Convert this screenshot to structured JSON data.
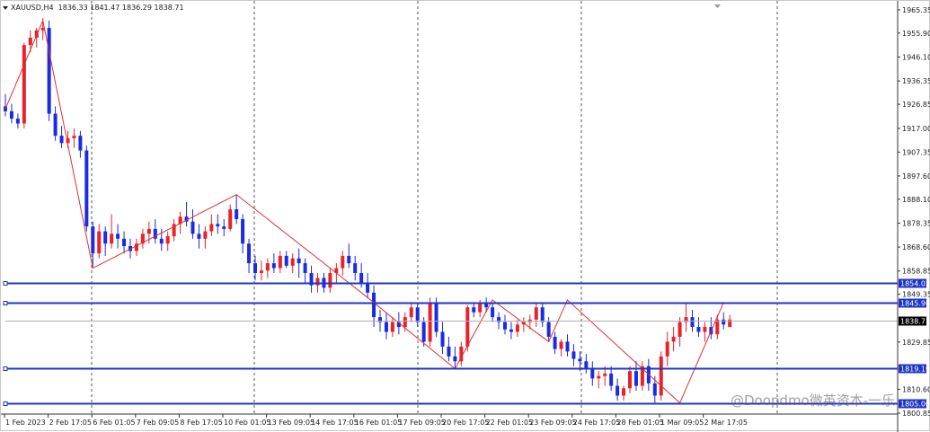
{
  "header": {
    "symbol_timeframe": "XAUUSD,H4",
    "ohlc": "1836.33 1841.47 1836.29 1838.71"
  },
  "watermark": "@Doopdmo微英资本-一乐",
  "colors": {
    "bull": "#e8222a",
    "bear": "#1a2be0",
    "zigzag": "#e03030",
    "level": "#1f35c8",
    "grid": "#555555",
    "current": "#000000"
  },
  "chart_data": {
    "type": "candlestick",
    "symbol": "XAUUSD",
    "timeframe": "H4",
    "ylim": [
      1800.85,
      1965.35
    ],
    "price_ticks": [
      1965.35,
      1955.9,
      1946.1,
      1936.35,
      1926.85,
      1917.0,
      1907.35,
      1897.6,
      1888.1,
      1878.35,
      1868.6,
      1858.85,
      1849.35,
      1829.85,
      1810.6,
      1800.85
    ],
    "time_labels": [
      "1 Feb 2023",
      "2 Feb 17:05",
      "6 Feb 01:05",
      "7 Feb 09:05",
      "8 Feb 17:05",
      "10 Feb 01:05",
      "13 Feb 09:05",
      "14 Feb 17:05",
      "16 Feb 01:05",
      "17 Feb 09:05",
      "20 Feb 17:05",
      "22 Feb 01:05",
      "23 Feb 09:05",
      "24 Feb 17:05",
      "28 Feb 01:05",
      "1 Mar 09:05",
      "2 Mar 17:05"
    ],
    "horizontal_levels": [
      {
        "price": 1854.02,
        "label": "1854.02"
      },
      {
        "price": 1845.96,
        "label": "1845.96"
      },
      {
        "price": 1819.19,
        "label": "1819.19"
      },
      {
        "price": 1805.0,
        "label": "1805.00"
      }
    ],
    "current_price": {
      "price": 1838.71,
      "label": "1838.71"
    },
    "candles": [
      [
        1926,
        1931,
        1922,
        1924
      ],
      [
        1924,
        1927,
        1919,
        1921
      ],
      [
        1921,
        1923,
        1917,
        1919
      ],
      [
        1919,
        1952,
        1917,
        1951
      ],
      [
        1951,
        1957,
        1948,
        1954
      ],
      [
        1954,
        1958,
        1950,
        1957
      ],
      [
        1957,
        1962,
        1953,
        1958
      ],
      [
        1958,
        1961,
        1920,
        1923
      ],
      [
        1923,
        1926,
        1912,
        1914
      ],
      [
        1914,
        1918,
        1909,
        1911
      ],
      [
        1911,
        1916,
        1909,
        1913
      ],
      [
        1913,
        1917,
        1909,
        1914
      ],
      [
        1914,
        1916,
        1905,
        1908
      ],
      [
        1908,
        1910,
        1875,
        1877
      ],
      [
        1877,
        1879,
        1860,
        1866
      ],
      [
        1866,
        1878,
        1864,
        1875
      ],
      [
        1875,
        1877,
        1865,
        1870
      ],
      [
        1870,
        1882,
        1868,
        1874
      ],
      [
        1874,
        1878,
        1868,
        1872
      ],
      [
        1872,
        1875,
        1866,
        1869
      ],
      [
        1869,
        1872,
        1864,
        1867
      ],
      [
        1867,
        1872,
        1865,
        1870
      ],
      [
        1870,
        1876,
        1868,
        1874
      ],
      [
        1874,
        1879,
        1870,
        1876
      ],
      [
        1876,
        1880,
        1870,
        1872
      ],
      [
        1872,
        1876,
        1867,
        1870
      ],
      [
        1870,
        1875,
        1867,
        1873
      ],
      [
        1873,
        1880,
        1871,
        1878
      ],
      [
        1878,
        1883,
        1874,
        1881
      ],
      [
        1881,
        1887,
        1877,
        1879
      ],
      [
        1879,
        1884,
        1872,
        1874
      ],
      [
        1874,
        1878,
        1868,
        1872
      ],
      [
        1872,
        1877,
        1868,
        1875
      ],
      [
        1875,
        1882,
        1873,
        1878
      ],
      [
        1878,
        1882,
        1874,
        1877
      ],
      [
        1877,
        1880,
        1873,
        1876
      ],
      [
        1876,
        1886,
        1875,
        1884
      ],
      [
        1884,
        1890,
        1878,
        1880
      ],
      [
        1880,
        1882,
        1866,
        1870
      ],
      [
        1870,
        1872,
        1858,
        1862
      ],
      [
        1862,
        1865,
        1855,
        1858
      ],
      [
        1858,
        1863,
        1855,
        1859
      ],
      [
        1859,
        1864,
        1856,
        1862
      ],
      [
        1862,
        1866,
        1858,
        1860
      ],
      [
        1860,
        1867,
        1858,
        1865
      ],
      [
        1865,
        1867,
        1860,
        1861
      ],
      [
        1861,
        1866,
        1858,
        1864
      ],
      [
        1864,
        1868,
        1856,
        1862
      ],
      [
        1862,
        1864,
        1854,
        1858
      ],
      [
        1858,
        1861,
        1850,
        1853
      ],
      [
        1853,
        1858,
        1850,
        1856
      ],
      [
        1856,
        1858,
        1850,
        1852
      ],
      [
        1852,
        1860,
        1850,
        1858
      ],
      [
        1858,
        1862,
        1854,
        1860
      ],
      [
        1860,
        1867,
        1857,
        1865
      ],
      [
        1865,
        1870,
        1860,
        1862
      ],
      [
        1862,
        1865,
        1855,
        1858
      ],
      [
        1858,
        1862,
        1852,
        1854
      ],
      [
        1854,
        1858,
        1848,
        1850
      ],
      [
        1850,
        1853,
        1836,
        1840
      ],
      [
        1840,
        1843,
        1834,
        1838
      ],
      [
        1838,
        1842,
        1831,
        1834
      ],
      [
        1834,
        1840,
        1832,
        1838
      ],
      [
        1838,
        1842,
        1833,
        1836
      ],
      [
        1836,
        1842,
        1834,
        1840
      ],
      [
        1840,
        1846,
        1838,
        1844
      ],
      [
        1844,
        1846,
        1836,
        1838
      ],
      [
        1838,
        1840,
        1828,
        1830
      ],
      [
        1830,
        1848,
        1828,
        1846
      ],
      [
        1846,
        1848,
        1832,
        1834
      ],
      [
        1834,
        1838,
        1825,
        1828
      ],
      [
        1828,
        1832,
        1822,
        1824
      ],
      [
        1824,
        1828,
        1819,
        1822
      ],
      [
        1822,
        1830,
        1820,
        1828
      ],
      [
        1828,
        1845,
        1826,
        1844
      ],
      [
        1844,
        1846,
        1840,
        1842
      ],
      [
        1842,
        1847,
        1840,
        1846
      ],
      [
        1846,
        1848,
        1842,
        1844
      ],
      [
        1844,
        1846,
        1838,
        1840
      ],
      [
        1840,
        1842,
        1835,
        1838
      ],
      [
        1838,
        1841,
        1833,
        1835
      ],
      [
        1835,
        1838,
        1831,
        1834
      ],
      [
        1834,
        1839,
        1832,
        1837
      ],
      [
        1837,
        1840,
        1834,
        1838
      ],
      [
        1838,
        1841,
        1835,
        1839
      ],
      [
        1839,
        1846,
        1836,
        1844
      ],
      [
        1844,
        1846,
        1836,
        1838
      ],
      [
        1838,
        1840,
        1830,
        1832
      ],
      [
        1832,
        1834,
        1825,
        1827
      ],
      [
        1827,
        1831,
        1824,
        1830
      ],
      [
        1830,
        1833,
        1824,
        1826
      ],
      [
        1826,
        1829,
        1820,
        1823
      ],
      [
        1823,
        1826,
        1818,
        1822
      ],
      [
        1822,
        1825,
        1817,
        1819
      ],
      [
        1819,
        1822,
        1812,
        1815
      ],
      [
        1815,
        1818,
        1811,
        1816
      ],
      [
        1816,
        1820,
        1812,
        1817
      ],
      [
        1817,
        1820,
        1810,
        1812
      ],
      [
        1812,
        1815,
        1806,
        1808
      ],
      [
        1808,
        1812,
        1806,
        1811
      ],
      [
        1811,
        1820,
        1809,
        1818
      ],
      [
        1818,
        1822,
        1810,
        1812
      ],
      [
        1812,
        1822,
        1810,
        1820
      ],
      [
        1820,
        1823,
        1810,
        1813
      ],
      [
        1813,
        1816,
        1805,
        1808
      ],
      [
        1808,
        1826,
        1806,
        1824
      ],
      [
        1824,
        1834,
        1820,
        1830
      ],
      [
        1830,
        1836,
        1826,
        1832
      ],
      [
        1832,
        1840,
        1828,
        1838
      ],
      [
        1838,
        1846,
        1834,
        1840
      ],
      [
        1840,
        1843,
        1834,
        1836
      ],
      [
        1836,
        1840,
        1832,
        1834
      ],
      [
        1834,
        1838,
        1830,
        1836
      ],
      [
        1836,
        1840,
        1831,
        1833
      ],
      [
        1833,
        1841,
        1831,
        1839
      ],
      [
        1839,
        1842,
        1835,
        1837
      ],
      [
        1836,
        1841,
        1836,
        1839
      ]
    ],
    "zigzag_points": [
      [
        0,
        1925
      ],
      [
        6,
        1961
      ],
      [
        14,
        1860
      ],
      [
        37,
        1890
      ],
      [
        58,
        1848
      ],
      [
        72,
        1819
      ],
      [
        78,
        1847
      ],
      [
        87,
        1830
      ],
      [
        90,
        1847
      ],
      [
        108,
        1805
      ],
      [
        115,
        1846
      ]
    ]
  }
}
